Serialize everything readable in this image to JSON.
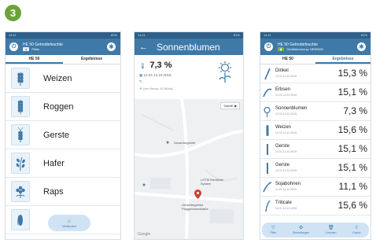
{
  "step_badge": "3",
  "colors": {
    "primary": "#3e79a8",
    "status_bar": "#2f5f87",
    "badge": "#6aa336",
    "accent_chip": "#7ab648",
    "light_panel": "#cfe3f4"
  },
  "screen1": {
    "status_time": "14:11",
    "status_right": "82%",
    "app_title": "HE 50 Getreidefeuchte",
    "app_subtitle": "Pillau",
    "tabs": [
      "HE 50",
      "Ergebnisse"
    ],
    "grains": [
      {
        "label": "Weizen",
        "icon": "wheat-icon"
      },
      {
        "label": "Roggen",
        "icon": "rye-icon"
      },
      {
        "label": "Gerste",
        "icon": "barley-icon"
      },
      {
        "label": "Hafer",
        "icon": "oats-icon"
      },
      {
        "label": "Raps",
        "icon": "rapeseed-icon"
      }
    ],
    "bottom_icon": "corn-icon",
    "fab_label": "Verbinden",
    "fab_icon": "house-icon"
  },
  "screen2": {
    "status_time": "14:11",
    "status_right": "81%",
    "title": "Sonnenblumen",
    "moisture": "7,3 %",
    "datetime": "12:24  14.10.2019",
    "location_note": "(ver Homa, 10 Stück)",
    "map_switch_label": "Satellit",
    "map_labels": [
      "Gewerbegebiet",
      "LGTM Renfields System",
      "Gewerbegebiet Plaggeboomstraße"
    ],
    "map_attribution": "Google"
  },
  "screen3": {
    "status_time": "14:11",
    "status_right": "81%",
    "app_title": "HE 50 Getreidefeuchte",
    "app_subtitle": "Gerätekennung: HE50028",
    "tabs": [
      "HE 50",
      "Ergebnisse"
    ],
    "results": [
      {
        "name": "Dinkel",
        "date": "12:24  14.10.2019",
        "value": "15,3 %"
      },
      {
        "name": "Erbsen",
        "date": "12:24  14.10.2019",
        "value": "15,1 %"
      },
      {
        "name": "Sonnenblumen",
        "date": "12:24  14.10.2019",
        "value": "7,3 %"
      },
      {
        "name": "Weizen",
        "date": "12:22  14.10.2019",
        "value": "15,6 %"
      },
      {
        "name": "Gerste",
        "date": "12:22  14.10.2019",
        "value": "15,1 %"
      },
      {
        "name": "Gerste",
        "date": "12:22  14.10.2019",
        "value": "15,1 %"
      },
      {
        "name": "Sojabohnen",
        "date": "12:21  14.10.2019",
        "value": "11,1 %"
      },
      {
        "name": "Triticale",
        "date": "12:21  14.10.2019",
        "value": "15,6 %"
      }
    ],
    "footer": [
      {
        "label": "Filter",
        "icon": "filter-icon"
      },
      {
        "label": "Einstellungen",
        "icon": "gear-icon"
      },
      {
        "label": "Löschen",
        "icon": "trash-icon"
      },
      {
        "label": "Export",
        "icon": "export-icon"
      }
    ]
  }
}
